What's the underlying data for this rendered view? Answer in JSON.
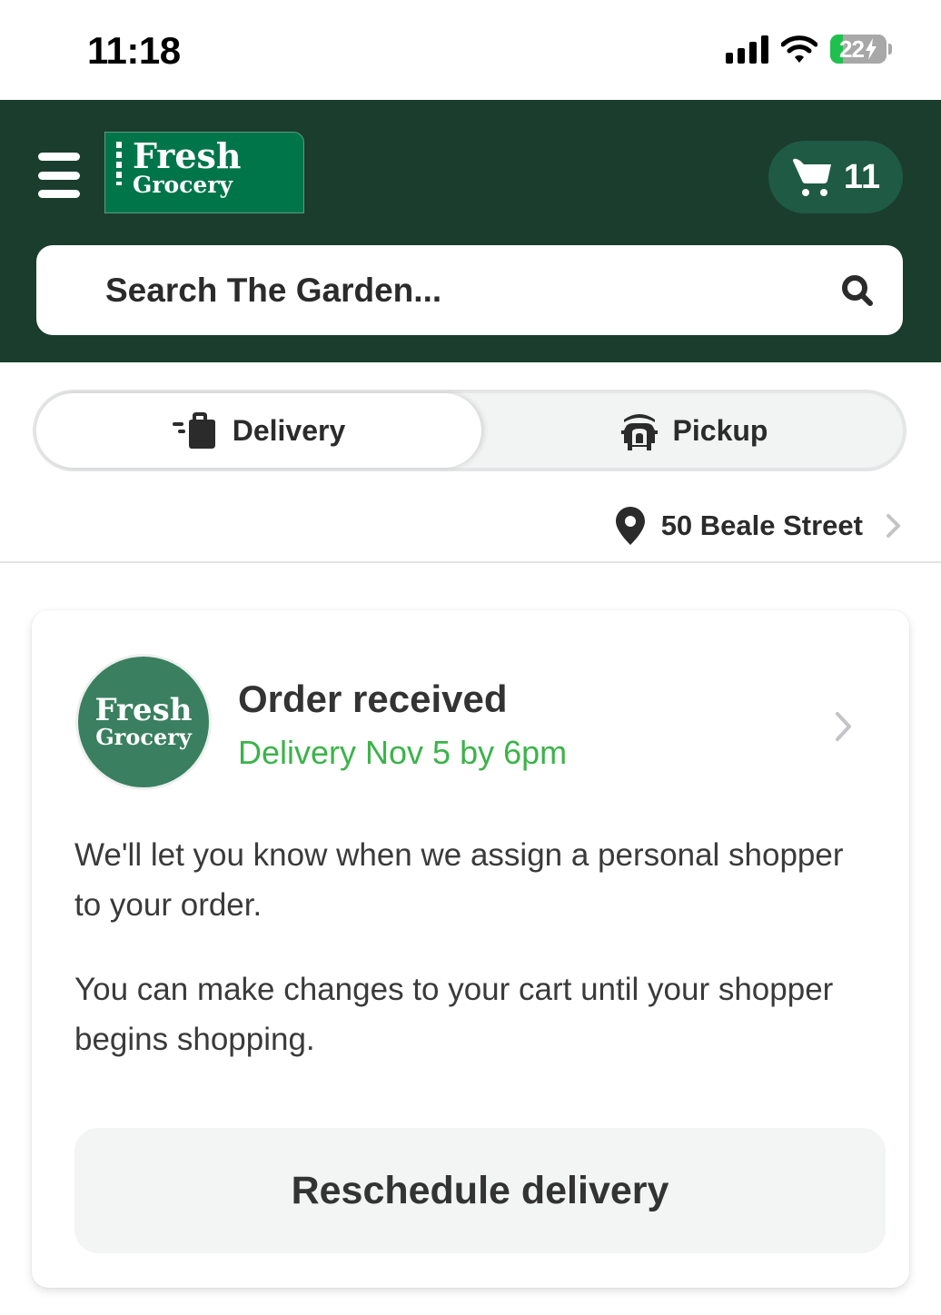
{
  "status_bar": {
    "time": "11:18",
    "signal_bars": 4,
    "wifi": "connected",
    "battery_percent": 22,
    "battery_label": "22",
    "charging": true,
    "icons": [
      "signal-icon",
      "wifi-icon",
      "battery-charging-icon"
    ]
  },
  "header": {
    "menu_icon": "hamburger-menu-icon",
    "logo": {
      "line1": "Fresh",
      "line2": "Grocery"
    },
    "cart": {
      "icon": "cart-icon",
      "count": "11"
    },
    "search": {
      "placeholder": "Search The Garden...",
      "value": "",
      "icon": "search-icon"
    },
    "colors": {
      "background": "#1a3d2e",
      "logo_green": "#00754a",
      "cart_pill": "#1f5a44"
    }
  },
  "fulfillment_toggle": {
    "options": [
      {
        "label": "Delivery",
        "icon": "delivery-bag-icon",
        "selected": true
      },
      {
        "label": "Pickup",
        "icon": "pickup-car-icon",
        "selected": false
      }
    ]
  },
  "address": {
    "icon": "location-pin-icon",
    "label": "50 Beale Street",
    "chevron": "chevron-right-icon"
  },
  "order_card": {
    "store_logo": {
      "line1": "Fresh",
      "line2": "Grocery"
    },
    "status": "Order received",
    "eta": "Delivery Nov 5 by 6pm",
    "messages": [
      "We'll let you know when we assign a personal shopper to your order.",
      "You can make changes to your cart until your shopper begins shopping."
    ],
    "action_label": "Reschedule delivery",
    "colors": {
      "eta_green": "#3cb34a",
      "avatar_green": "#3a8060"
    }
  }
}
